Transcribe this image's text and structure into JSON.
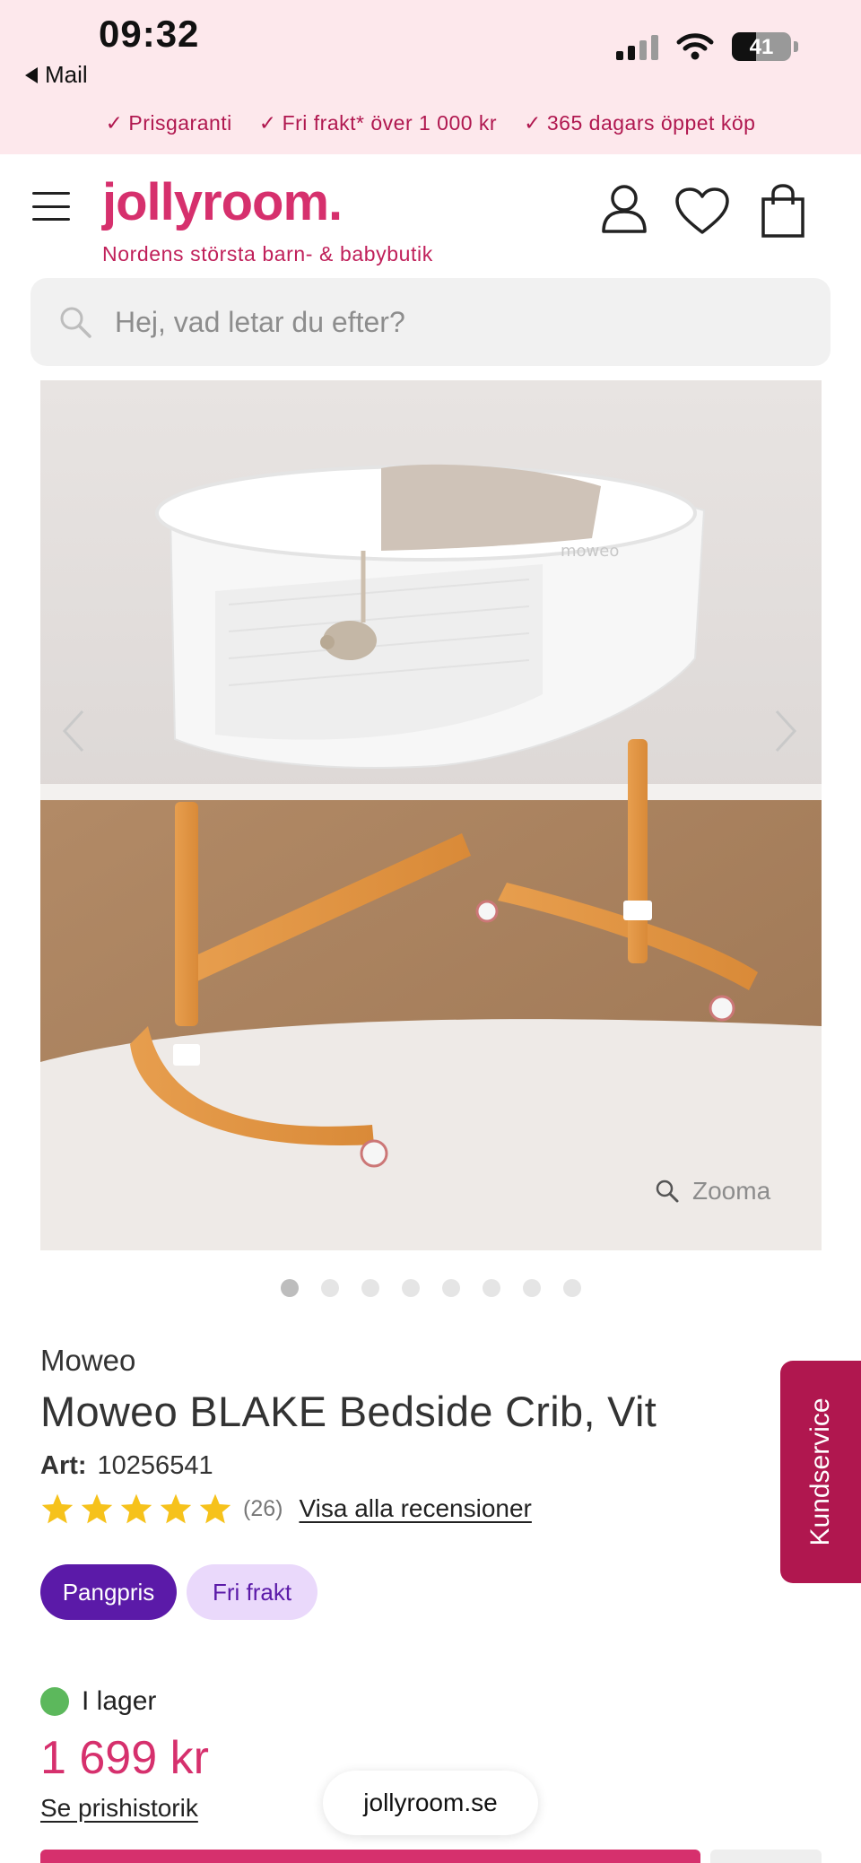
{
  "status_bar": {
    "time": "09:32",
    "back_label": "Mail",
    "battery_percent": "41",
    "signal_bars": 4,
    "signal_bars_active": 2
  },
  "promo": {
    "items": [
      "Prisgaranti",
      "Fri frakt* över 1 000 kr",
      "365 dagars öppet köp"
    ]
  },
  "header": {
    "logo": "jollyroom.",
    "tagline": "Nordens största barn- & babybutik",
    "icons": [
      "menu-icon",
      "user-icon",
      "heart-icon",
      "shopping-bag-icon"
    ]
  },
  "search": {
    "placeholder": "Hej, vad letar du efter?"
  },
  "gallery": {
    "zoom_label": "Zooma",
    "total_images": 8,
    "active_index": 0
  },
  "product": {
    "brand": "Moweo",
    "title": "Moweo BLAKE Bedside Crib, Vit",
    "art_label": "Art:",
    "art_number": "10256541",
    "rating": 5,
    "review_count": "(26)",
    "all_reviews_label": "Visa alla recensioner",
    "badges": [
      "Pangpris",
      "Fri frakt"
    ],
    "stock_label": "I lager",
    "price": "1 699 kr",
    "price_history_label": "Se prishistorik"
  },
  "browser": {
    "url": "jollyroom.se"
  },
  "side_tab": {
    "label": "Kundservice"
  },
  "colors": {
    "brand_pink": "#d6306d",
    "promo_bg": "#fde8ec",
    "badge_purple": "#5b1aa8",
    "badge_lilac": "#ead9fb",
    "stock_green": "#5cb85c",
    "star_yellow": "#f6c21b",
    "kundservice_bg": "#b0174f"
  }
}
